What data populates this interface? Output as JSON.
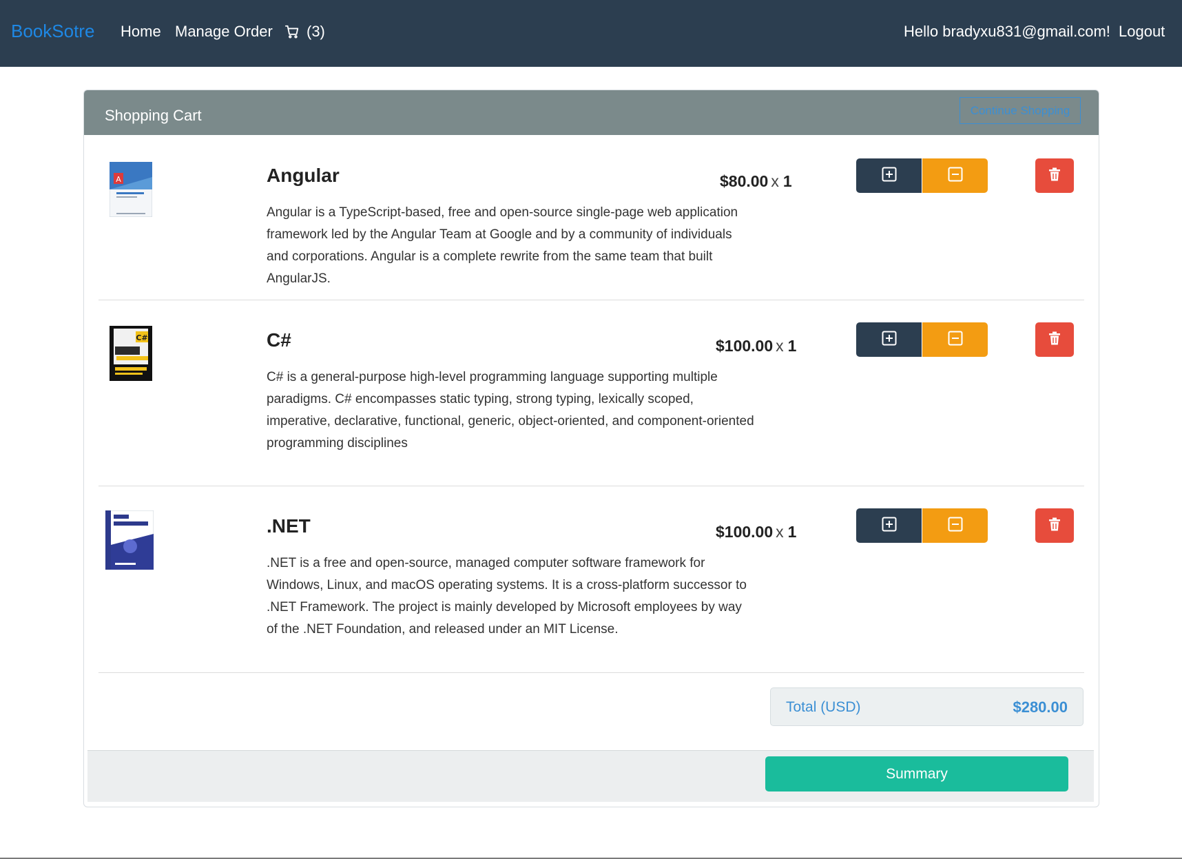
{
  "nav": {
    "brand": "BookSotre",
    "home": "Home",
    "manage_order": "Manage Order",
    "cart_count": "(3)",
    "greeting": "Hello bradyxu831@gmail.com!",
    "logout": "Logout"
  },
  "cart": {
    "title": "Shopping Cart",
    "continue_label": "Continue Shopping",
    "items": [
      {
        "title": "Angular",
        "description": "Angular is a TypeScript-based, free and open-source single-page web application framework led by the Angular Team at Google and by a community of individuals and corporations. Angular is a complete rewrite from the same team that built AngularJS.",
        "price": "$80.00",
        "times": "x",
        "qty": "1"
      },
      {
        "title": "C#",
        "description": "C# is a general-purpose high-level programming language supporting multiple paradigms. C# encompasses static typing, strong typing, lexically scoped, imperative, declarative, functional, generic, object-oriented, and component-oriented programming disciplines",
        "price": "$100.00",
        "times": "x",
        "qty": "1"
      },
      {
        "title": ".NET",
        "description": ".NET is a free and open-source, managed computer software framework for Windows, Linux, and macOS operating systems. It is a cross-platform successor to .NET Framework. The project is mainly developed by Microsoft employees by way of the .NET Foundation, and released under an MIT License.",
        "price": "$100.00",
        "times": "x",
        "qty": "1"
      }
    ],
    "total_label": "Total (USD)",
    "total_value": "$280.00",
    "summary_label": "Summary"
  },
  "colors": {
    "navbar": "#2c3e50",
    "brand": "#1e88e5",
    "header": "#7b8a8b",
    "plus": "#2c3e50",
    "minus": "#f39c12",
    "delete": "#e74c3c",
    "summary": "#1abc9c",
    "total_text": "#3b8fd4"
  },
  "icons": {
    "cart": "cart-icon",
    "plus": "plus-square-icon",
    "minus": "minus-square-icon",
    "delete": "trash-icon"
  }
}
